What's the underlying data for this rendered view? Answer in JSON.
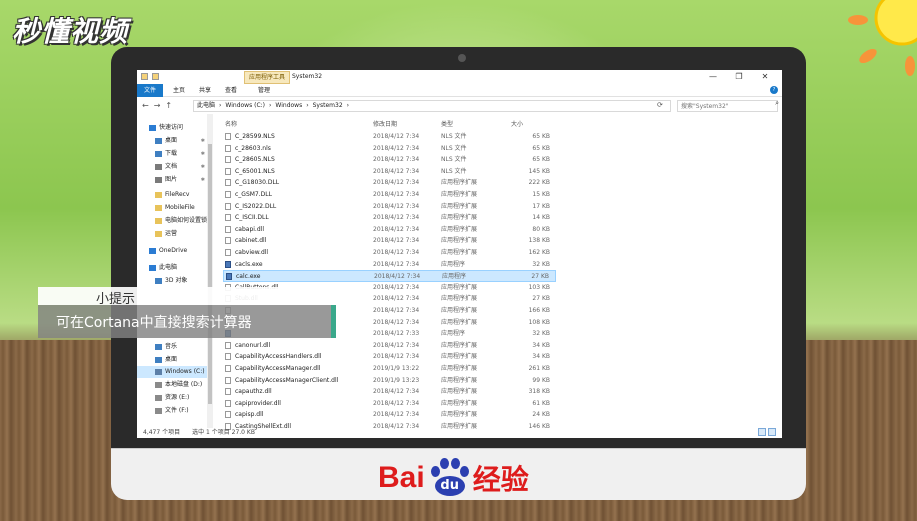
{
  "brand": "秒懂视频",
  "monitor_logo": {
    "bai": "Bai",
    "du": "du",
    "jingyan": "经验"
  },
  "window": {
    "title": "System32",
    "context_tab": "应用程序工具",
    "controls": [
      "—",
      "❐",
      "✕"
    ]
  },
  "ribbon": {
    "tabs": [
      "文件",
      "主页",
      "共享",
      "查看",
      "管理"
    ]
  },
  "address": {
    "crumbs": [
      "此电脑",
      "›",
      "Windows (C:)",
      "›",
      "Windows",
      "›",
      "System32",
      "›"
    ],
    "search_placeholder": "搜索\"System32\""
  },
  "sidebar": {
    "items": [
      {
        "label": "快速访问",
        "icon": "star-icon",
        "color": "#2b7cd3",
        "pin": ""
      },
      {
        "label": "桌面",
        "icon": "folder-icon",
        "color": "#3f7fc1",
        "pin": "✱"
      },
      {
        "label": "下载",
        "icon": "download-icon",
        "color": "#3f7fc1",
        "pin": "✱"
      },
      {
        "label": "文档",
        "icon": "folder-icon",
        "color": "#7a7a7a",
        "pin": "✱"
      },
      {
        "label": "图片",
        "icon": "folder-icon",
        "color": "#7a7a7a",
        "pin": "✱"
      },
      {
        "label": "FileRecv",
        "icon": "folder-icon",
        "color": "#e8c35a",
        "pin": ""
      },
      {
        "label": "MobileFile",
        "icon": "folder-icon",
        "color": "#e8c35a",
        "pin": ""
      },
      {
        "label": "电脑如何设置锁",
        "icon": "folder-icon",
        "color": "#e8c35a",
        "pin": ""
      },
      {
        "label": "运营",
        "icon": "folder-icon",
        "color": "#e8c35a",
        "pin": ""
      },
      {
        "label": "OneDrive",
        "icon": "cloud-icon",
        "color": "#2b7cd3",
        "pin": ""
      },
      {
        "label": "此电脑",
        "icon": "computer-icon",
        "color": "#2b7cd3",
        "pin": ""
      },
      {
        "label": "3D 对象",
        "icon": "folder-icon",
        "color": "#3f7fc1",
        "pin": ""
      },
      {
        "label": "音乐",
        "icon": "music-icon",
        "color": "#3f7fc1",
        "pin": ""
      },
      {
        "label": "桌面",
        "icon": "folder-icon",
        "color": "#3f7fc1",
        "pin": ""
      },
      {
        "label": "Windows (C:)",
        "icon": "drive-icon",
        "color": "#5c7fa8",
        "pin": ""
      },
      {
        "label": "本地磁盘 (D:)",
        "icon": "drive-icon",
        "color": "#8a8a8a",
        "pin": ""
      },
      {
        "label": "资源 (E:)",
        "icon": "drive-icon",
        "color": "#8a8a8a",
        "pin": ""
      },
      {
        "label": "文件 (F:)",
        "icon": "drive-icon",
        "color": "#8a8a8a",
        "pin": ""
      }
    ]
  },
  "columns": {
    "name": "名称",
    "date": "修改日期",
    "type": "类型",
    "size": "大小"
  },
  "files": [
    {
      "name": "C_28599.NLS",
      "date": "2018/4/12 7:34",
      "type": "NLS 文件",
      "size": "65 KB",
      "exe": false
    },
    {
      "name": "c_28603.nls",
      "date": "2018/4/12 7:34",
      "type": "NLS 文件",
      "size": "65 KB",
      "exe": false
    },
    {
      "name": "C_28605.NLS",
      "date": "2018/4/12 7:34",
      "type": "NLS 文件",
      "size": "65 KB",
      "exe": false
    },
    {
      "name": "C_65001.NLS",
      "date": "2018/4/12 7:34",
      "type": "NLS 文件",
      "size": "145 KB",
      "exe": false
    },
    {
      "name": "C_G18030.DLL",
      "date": "2018/4/12 7:34",
      "type": "应用程序扩展",
      "size": "222 KB",
      "exe": false
    },
    {
      "name": "c_GSM7.DLL",
      "date": "2018/4/12 7:34",
      "type": "应用程序扩展",
      "size": "15 KB",
      "exe": false
    },
    {
      "name": "C_IS2022.DLL",
      "date": "2018/4/12 7:34",
      "type": "应用程序扩展",
      "size": "17 KB",
      "exe": false
    },
    {
      "name": "C_ISCII.DLL",
      "date": "2018/4/12 7:34",
      "type": "应用程序扩展",
      "size": "14 KB",
      "exe": false
    },
    {
      "name": "cabapi.dll",
      "date": "2018/4/12 7:34",
      "type": "应用程序扩展",
      "size": "80 KB",
      "exe": false
    },
    {
      "name": "cabinet.dll",
      "date": "2018/4/12 7:34",
      "type": "应用程序扩展",
      "size": "138 KB",
      "exe": false
    },
    {
      "name": "cabview.dll",
      "date": "2018/4/12 7:34",
      "type": "应用程序扩展",
      "size": "162 KB",
      "exe": false
    },
    {
      "name": "cacls.exe",
      "date": "2018/4/12 7:34",
      "type": "应用程序",
      "size": "32 KB",
      "exe": true
    },
    {
      "name": "calc.exe",
      "date": "2018/4/12 7:34",
      "type": "应用程序",
      "size": "27 KB",
      "exe": true,
      "selected": true
    },
    {
      "name": "CallButtons.dll",
      "date": "2018/4/12 7:34",
      "type": "应用程序扩展",
      "size": "103 KB",
      "exe": false
    },
    {
      "name": "Stub.dll",
      "date": "2018/4/12 7:34",
      "type": "应用程序扩展",
      "size": "27 KB",
      "exe": false
    },
    {
      "name": "",
      "date": "2018/4/12 7:34",
      "type": "应用程序扩展",
      "size": "166 KB",
      "exe": false
    },
    {
      "name": "",
      "date": "2018/4/12 7:34",
      "type": "应用程序扩展",
      "size": "108 KB",
      "exe": false
    },
    {
      "name": "",
      "date": "2018/4/12 7:33",
      "type": "应用程序",
      "size": "32 KB",
      "exe": true
    },
    {
      "name": "canonurl.dll",
      "date": "2018/4/12 7:34",
      "type": "应用程序扩展",
      "size": "34 KB",
      "exe": false
    },
    {
      "name": "CapabilityAccessHandlers.dll",
      "date": "2018/4/12 7:34",
      "type": "应用程序扩展",
      "size": "34 KB",
      "exe": false
    },
    {
      "name": "CapabilityAccessManager.dll",
      "date": "2019/1/9 13:22",
      "type": "应用程序扩展",
      "size": "261 KB",
      "exe": false
    },
    {
      "name": "CapabilityAccessManagerClient.dll",
      "date": "2019/1/9 13:23",
      "type": "应用程序扩展",
      "size": "99 KB",
      "exe": false
    },
    {
      "name": "capauthz.dll",
      "date": "2018/4/12 7:34",
      "type": "应用程序扩展",
      "size": "318 KB",
      "exe": false
    },
    {
      "name": "capiprovider.dll",
      "date": "2018/4/12 7:34",
      "type": "应用程序扩展",
      "size": "61 KB",
      "exe": false
    },
    {
      "name": "capisp.dll",
      "date": "2018/4/12 7:34",
      "type": "应用程序扩展",
      "size": "24 KB",
      "exe": false
    },
    {
      "name": "CastingShellExt.dll",
      "date": "2018/4/12 7:34",
      "type": "应用程序扩展",
      "size": "146 KB",
      "exe": false
    }
  ],
  "status": {
    "count": "4,477 个项目",
    "selected": "选中 1 个项目  27.0 KB"
  },
  "tip": {
    "title": "小提示",
    "body": "可在Cortana中直接搜索计算器"
  }
}
